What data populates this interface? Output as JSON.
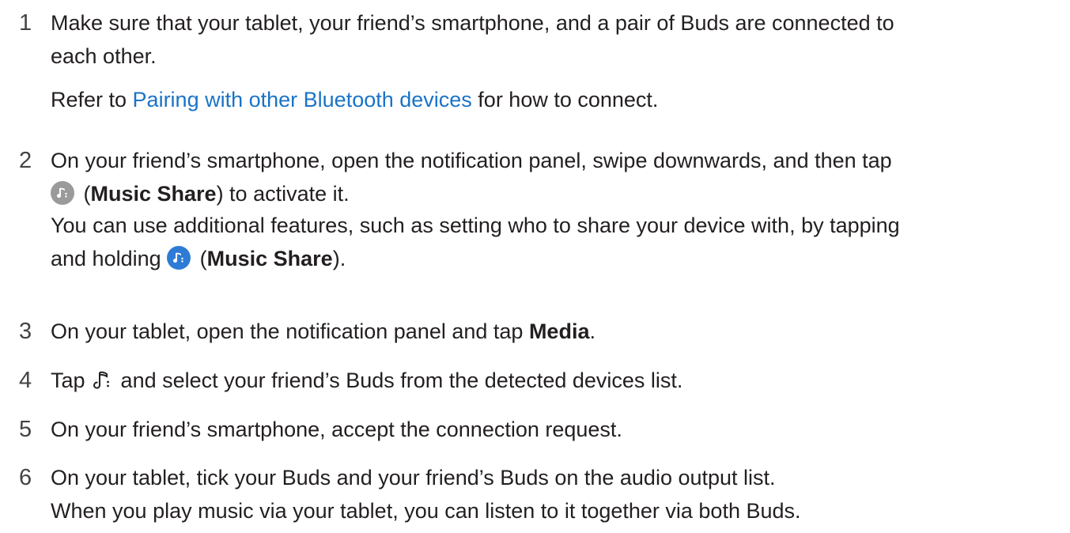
{
  "steps": [
    {
      "number": "1",
      "line1": "Make sure that your tablet, your friend’s smartphone, and a pair of Buds are connected to",
      "line2": "each other.",
      "sub_pre": "Refer to ",
      "sub_link": "Pairing with other Bluetooth devices",
      "sub_post": " for how to connect."
    },
    {
      "number": "2",
      "line1": "On your friend’s smartphone, open the notification panel, swipe downwards, and then tap",
      "line2_open": " (",
      "line2_bold": "Music Share",
      "line2_post": ") to activate it.",
      "sub_line1": "You can use additional features, such as setting who to share your device with, by tapping",
      "sub_line2_pre": "and holding ",
      "sub_line2_open": " (",
      "sub_line2_bold": "Music Share",
      "sub_line2_post": ")."
    },
    {
      "number": "3",
      "pre": "On your tablet, open the notification panel and tap ",
      "bold": "Media",
      "post": "."
    },
    {
      "number": "4",
      "pre": "Tap ",
      "post": " and select your friend’s Buds from the detected devices list."
    },
    {
      "number": "5",
      "text": "On your friend’s smartphone, accept the connection request."
    },
    {
      "number": "6",
      "line1": "On your tablet, tick your Buds and your friend’s Buds on the audio output list.",
      "line2": "When you play music via your tablet, you can listen to it together via both Buds."
    }
  ],
  "icons": {
    "music_share_inactive": "music-share-icon-grey",
    "music_share_active": "music-share-icon-blue",
    "music_share_outline": "music-share-outline-icon"
  },
  "colors": {
    "link": "#1a73c7",
    "icon_inactive": "#9a9a9a",
    "icon_active": "#2e7bd6"
  }
}
